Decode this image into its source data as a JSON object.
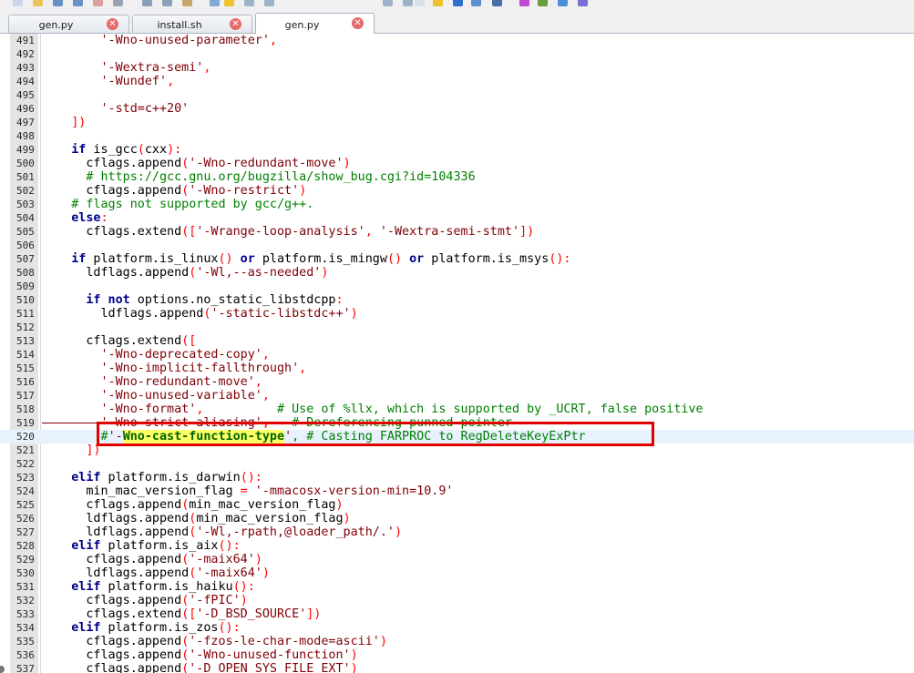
{
  "tabs": [
    {
      "label": "gen.py",
      "active": false
    },
    {
      "label": "install.sh",
      "active": false
    },
    {
      "label": "gen.py",
      "active": true
    }
  ],
  "tab_close_glyph": "✕",
  "editor": {
    "current_line": 520,
    "highlight_line": 520,
    "lines": [
      {
        "n": "491",
        "t": [
          [
            "s",
            "        '-Wno-unused-parameter'"
          ],
          [
            "o",
            ","
          ]
        ]
      },
      {
        "n": "492",
        "t": []
      },
      {
        "n": "493",
        "t": [
          [
            "s",
            "        '-Wextra-semi'"
          ],
          [
            "o",
            ","
          ]
        ]
      },
      {
        "n": "494",
        "t": [
          [
            "s",
            "        '-Wundef'"
          ],
          [
            "o",
            ","
          ]
        ]
      },
      {
        "n": "495",
        "t": []
      },
      {
        "n": "496",
        "t": [
          [
            "s",
            "        '-std=c++20'"
          ]
        ]
      },
      {
        "n": "497",
        "t": [
          [
            "o",
            "    ])"
          ]
        ]
      },
      {
        "n": "498",
        "t": []
      },
      {
        "n": "499",
        "t": [
          [
            "k",
            "    if"
          ],
          [
            "p",
            " is_gcc"
          ],
          [
            "o",
            "("
          ],
          [
            "p",
            "cxx"
          ],
          [
            "o",
            "):"
          ]
        ]
      },
      {
        "n": "500",
        "t": [
          [
            "p",
            "      cflags.append"
          ],
          [
            "o",
            "("
          ],
          [
            "s",
            "'-Wno-redundant-move'"
          ],
          [
            "o",
            ")"
          ]
        ]
      },
      {
        "n": "501",
        "t": [
          [
            "c",
            "      # https://gcc.gnu.org/bugzilla/show_bug.cgi?id=104336"
          ]
        ]
      },
      {
        "n": "502",
        "t": [
          [
            "p",
            "      cflags.append"
          ],
          [
            "o",
            "("
          ],
          [
            "s",
            "'-Wno-restrict'"
          ],
          [
            "o",
            ")"
          ]
        ]
      },
      {
        "n": "503",
        "t": [
          [
            "c",
            "    # flags not supported by gcc/g++."
          ]
        ]
      },
      {
        "n": "504",
        "t": [
          [
            "k",
            "    else"
          ],
          [
            "o",
            ":"
          ]
        ]
      },
      {
        "n": "505",
        "t": [
          [
            "p",
            "      cflags.extend"
          ],
          [
            "o",
            "(["
          ],
          [
            "s",
            "'-Wrange-loop-analysis'"
          ],
          [
            "o",
            ", "
          ],
          [
            "s",
            "'-Wextra-semi-stmt'"
          ],
          [
            "o",
            "])"
          ]
        ]
      },
      {
        "n": "506",
        "t": []
      },
      {
        "n": "507",
        "t": [
          [
            "k",
            "    if"
          ],
          [
            "p",
            " platform.is_linux"
          ],
          [
            "o",
            "()"
          ],
          [
            "k",
            " or"
          ],
          [
            "p",
            " platform.is_mingw"
          ],
          [
            "o",
            "()"
          ],
          [
            "k",
            " or"
          ],
          [
            "p",
            " platform.is_msys"
          ],
          [
            "o",
            "():"
          ]
        ]
      },
      {
        "n": "508",
        "t": [
          [
            "p",
            "      ldflags.append"
          ],
          [
            "o",
            "("
          ],
          [
            "s",
            "'-Wl,--as-needed'"
          ],
          [
            "o",
            ")"
          ]
        ]
      },
      {
        "n": "509",
        "t": []
      },
      {
        "n": "510",
        "t": [
          [
            "k",
            "      if not"
          ],
          [
            "p",
            " options.no_static_libstdcpp"
          ],
          [
            "o",
            ":"
          ]
        ]
      },
      {
        "n": "511",
        "t": [
          [
            "p",
            "        ldflags.append"
          ],
          [
            "o",
            "("
          ],
          [
            "s",
            "'-static-libstdc++'"
          ],
          [
            "o",
            ")"
          ]
        ]
      },
      {
        "n": "512",
        "t": []
      },
      {
        "n": "513",
        "t": [
          [
            "p",
            "      cflags.extend"
          ],
          [
            "o",
            "(["
          ]
        ]
      },
      {
        "n": "514",
        "t": [
          [
            "s",
            "        '-Wno-deprecated-copy'"
          ],
          [
            "o",
            ","
          ]
        ]
      },
      {
        "n": "515",
        "t": [
          [
            "s",
            "        '-Wno-implicit-fallthrough'"
          ],
          [
            "o",
            ","
          ]
        ]
      },
      {
        "n": "516",
        "t": [
          [
            "s",
            "        '-Wno-redundant-move'"
          ],
          [
            "o",
            ","
          ]
        ]
      },
      {
        "n": "517",
        "t": [
          [
            "s",
            "        '-Wno-unused-variable'"
          ],
          [
            "o",
            ","
          ]
        ]
      },
      {
        "n": "518",
        "t": [
          [
            "s",
            "        '-Wno-format'"
          ],
          [
            "o",
            ",          "
          ],
          [
            "c",
            "# Use of %llx, which is supported by _UCRT, false positive"
          ]
        ]
      },
      {
        "n": "519",
        "t": [
          [
            "x",
            "        '-Wno-strict-aliasing'"
          ],
          [
            "o",
            ",   "
          ],
          [
            "y",
            "# Dereferencing punned pointer"
          ]
        ]
      },
      {
        "n": "520",
        "t": [
          [
            "c",
            "        #"
          ],
          [
            "s",
            "'-"
          ],
          [
            "h",
            "Wno-cast-function-type"
          ],
          [
            "s",
            "'"
          ],
          [
            "c",
            ", # Casting FARPROC to RegDeleteKeyExPtr"
          ]
        ]
      },
      {
        "n": "521",
        "t": [
          [
            "o",
            "      ])"
          ]
        ]
      },
      {
        "n": "522",
        "t": []
      },
      {
        "n": "523",
        "t": [
          [
            "k",
            "    elif"
          ],
          [
            "p",
            " platform.is_darwin"
          ],
          [
            "o",
            "():"
          ]
        ]
      },
      {
        "n": "524",
        "t": [
          [
            "p",
            "      min_mac_version_flag "
          ],
          [
            "o",
            "="
          ],
          [
            "s",
            " '-mmacosx-version-min=10.9'"
          ]
        ]
      },
      {
        "n": "525",
        "t": [
          [
            "p",
            "      cflags.append"
          ],
          [
            "o",
            "("
          ],
          [
            "p",
            "min_mac_version_flag"
          ],
          [
            "o",
            ")"
          ]
        ]
      },
      {
        "n": "526",
        "t": [
          [
            "p",
            "      ldflags.append"
          ],
          [
            "o",
            "("
          ],
          [
            "p",
            "min_mac_version_flag"
          ],
          [
            "o",
            ")"
          ]
        ]
      },
      {
        "n": "527",
        "t": [
          [
            "p",
            "      ldflags.append"
          ],
          [
            "o",
            "("
          ],
          [
            "s",
            "'-Wl,-rpath,@loader_path/.'"
          ],
          [
            "o",
            ")"
          ]
        ]
      },
      {
        "n": "528",
        "t": [
          [
            "k",
            "    elif"
          ],
          [
            "p",
            " platform.is_aix"
          ],
          [
            "o",
            "():"
          ]
        ]
      },
      {
        "n": "529",
        "t": [
          [
            "p",
            "      cflags.append"
          ],
          [
            "o",
            "("
          ],
          [
            "s",
            "'-maix64'"
          ],
          [
            "o",
            ")"
          ]
        ]
      },
      {
        "n": "530",
        "t": [
          [
            "p",
            "      ldflags.append"
          ],
          [
            "o",
            "("
          ],
          [
            "s",
            "'-maix64'"
          ],
          [
            "o",
            ")"
          ]
        ]
      },
      {
        "n": "531",
        "t": [
          [
            "k",
            "    elif"
          ],
          [
            "p",
            " platform.is_haiku"
          ],
          [
            "o",
            "():"
          ]
        ]
      },
      {
        "n": "532",
        "t": [
          [
            "p",
            "      cflags.append"
          ],
          [
            "o",
            "("
          ],
          [
            "s",
            "'-fPIC'"
          ],
          [
            "o",
            ")"
          ]
        ]
      },
      {
        "n": "533",
        "t": [
          [
            "p",
            "      cflags.extend"
          ],
          [
            "o",
            "(["
          ],
          [
            "s",
            "'-D_BSD_SOURCE'"
          ],
          [
            "o",
            "])"
          ]
        ]
      },
      {
        "n": "534",
        "t": [
          [
            "k",
            "    elif"
          ],
          [
            "p",
            " platform.is_zos"
          ],
          [
            "o",
            "():"
          ]
        ]
      },
      {
        "n": "535",
        "t": [
          [
            "p",
            "      cflags.append"
          ],
          [
            "o",
            "("
          ],
          [
            "s",
            "'-fzos-le-char-mode=ascii'"
          ],
          [
            "o",
            ")"
          ]
        ]
      },
      {
        "n": "536",
        "t": [
          [
            "p",
            "      cflags.append"
          ],
          [
            "o",
            "("
          ],
          [
            "s",
            "'-Wno-unused-function'"
          ],
          [
            "o",
            ")"
          ]
        ]
      },
      {
        "n": "537",
        "t": [
          [
            "p",
            "      cflags.append"
          ],
          [
            "o",
            "("
          ],
          [
            "s",
            "'-D_OPEN_SYS_FILE_EXT'"
          ],
          [
            "o",
            ")"
          ]
        ]
      }
    ]
  },
  "colors": {
    "keyword": "#00008b",
    "string": "#7f0007",
    "comment": "#008000",
    "operator": "#ff0000",
    "highlight": "#ffff66",
    "annotation_box": "#e00000"
  }
}
